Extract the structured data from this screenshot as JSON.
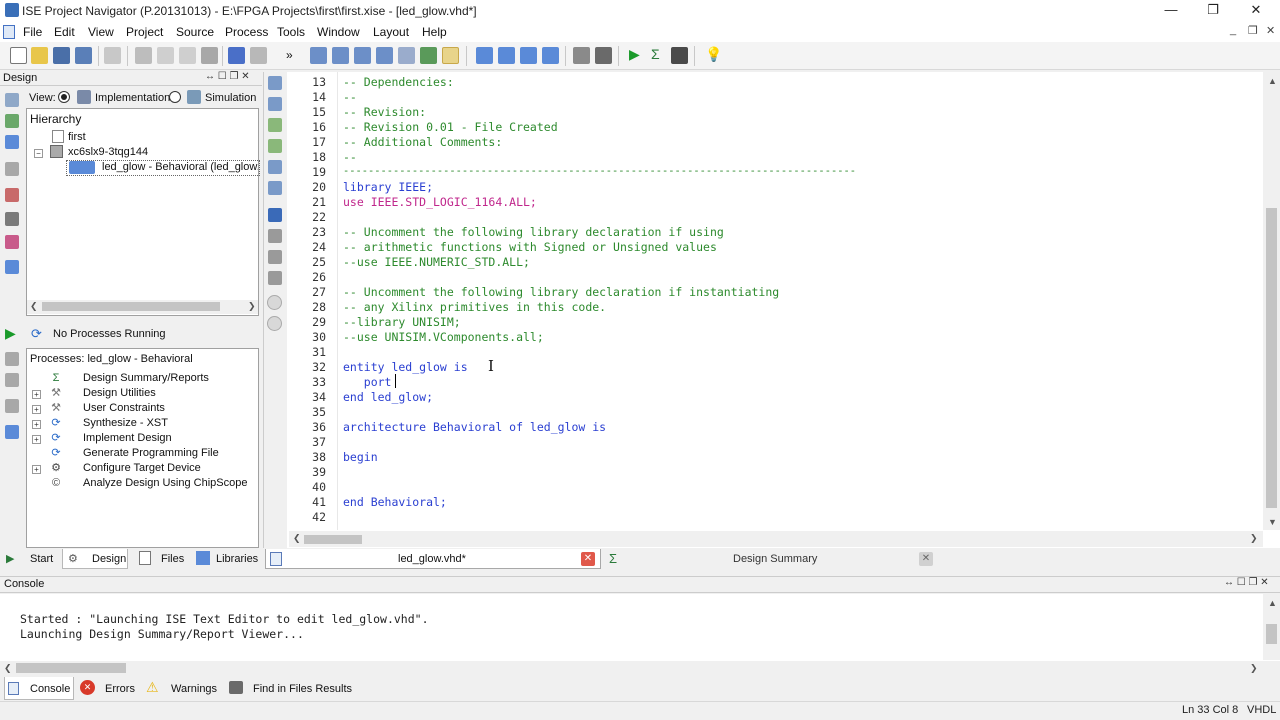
{
  "window": {
    "title": "ISE Project Navigator (P.20131013) - E:\\FPGA Projects\\first\\first.xise - [led_glow.vhd*]",
    "controls": {
      "minimize": "—",
      "maximize": "❐",
      "close": "✕"
    }
  },
  "menu": {
    "items": [
      "File",
      "Edit",
      "View",
      "Project",
      "Source",
      "Process",
      "Tools",
      "Window",
      "Layout",
      "Help"
    ],
    "mdi_controls": {
      "minimize": "_",
      "restore": "❐",
      "close": "✕"
    }
  },
  "design_panel": {
    "title": "Design",
    "view_label": "View:",
    "view_implementation": "Implementation",
    "view_simulation": "Simulation",
    "hierarchy_label": "Hierarchy",
    "tree": [
      {
        "label": "first",
        "level": 0
      },
      {
        "label": "xc6slx9-3tqg144",
        "level": 0
      },
      {
        "label": "led_glow - Behavioral (led_glow.vhd)",
        "level": 1
      }
    ],
    "status": "No Processes Running",
    "processes_label": "Processes: led_glow - Behavioral",
    "processes": [
      {
        "label": "Design Summary/Reports",
        "icon": "sigma-icon",
        "expandable": false
      },
      {
        "label": "Design Utilities",
        "icon": "tools-icon",
        "expandable": true
      },
      {
        "label": "User Constraints",
        "icon": "constraints-icon",
        "expandable": true
      },
      {
        "label": "Synthesize - XST",
        "icon": "refresh-icon",
        "expandable": true
      },
      {
        "label": "Implement Design",
        "icon": "refresh-icon",
        "expandable": true
      },
      {
        "label": "Generate Programming File",
        "icon": "refresh-icon",
        "expandable": false
      },
      {
        "label": "Configure Target Device",
        "icon": "device-icon",
        "expandable": true
      },
      {
        "label": "Analyze Design Using ChipScope",
        "icon": "chipscope-icon",
        "expandable": false
      }
    ]
  },
  "left_tabs": [
    "Start",
    "Design",
    "Files",
    "Libraries"
  ],
  "editor": {
    "tabs": [
      {
        "label": "led_glow.vhd*",
        "active": true
      },
      {
        "label": "Design Summary",
        "active": false
      }
    ],
    "line_numbers": [
      "13",
      "14",
      "15",
      "16",
      "17",
      "18",
      "19",
      "20",
      "21",
      "22",
      "23",
      "24",
      "25",
      "26",
      "27",
      "28",
      "29",
      "30",
      "31",
      "32",
      "33",
      "34",
      "35",
      "36",
      "37",
      "38",
      "39",
      "40",
      "41",
      "42"
    ],
    "lines": [
      "-- Dependencies:",
      "--",
      "-- Revision:",
      "-- Revision 0.01 - File Created",
      "-- Additional Comments:",
      "--",
      "----------------------------------------------------------------------------------",
      "library IEEE;",
      "use IEEE.STD_LOGIC_1164.ALL;",
      "",
      "-- Uncomment the following library declaration if using",
      "-- arithmetic functions with Signed or Unsigned values",
      "--use IEEE.NUMERIC_STD.ALL;",
      "",
      "-- Uncomment the following library declaration if instantiating",
      "-- any Xilinx primitives in this code.",
      "--library UNISIM;",
      "--use UNISIM.VComponents.all;",
      "",
      "entity led_glow is",
      "   port",
      "end led_glow;",
      "",
      "architecture Behavioral of led_glow is",
      "",
      "begin",
      "",
      "",
      "end Behavioral;",
      ""
    ]
  },
  "console": {
    "title": "Console",
    "lines": [
      "Started : \"Launching ISE Text Editor to edit led_glow.vhd\".",
      "Launching Design Summary/Report Viewer..."
    ],
    "tabs": [
      "Console",
      "Errors",
      "Warnings",
      "Find in Files Results"
    ]
  },
  "statusbar": {
    "position": "Ln 33 Col 8",
    "language": "VHDL"
  },
  "colors": {
    "comment": "#2d8a2d",
    "keyword": "#2a3fd1",
    "library": "#c0278c"
  }
}
